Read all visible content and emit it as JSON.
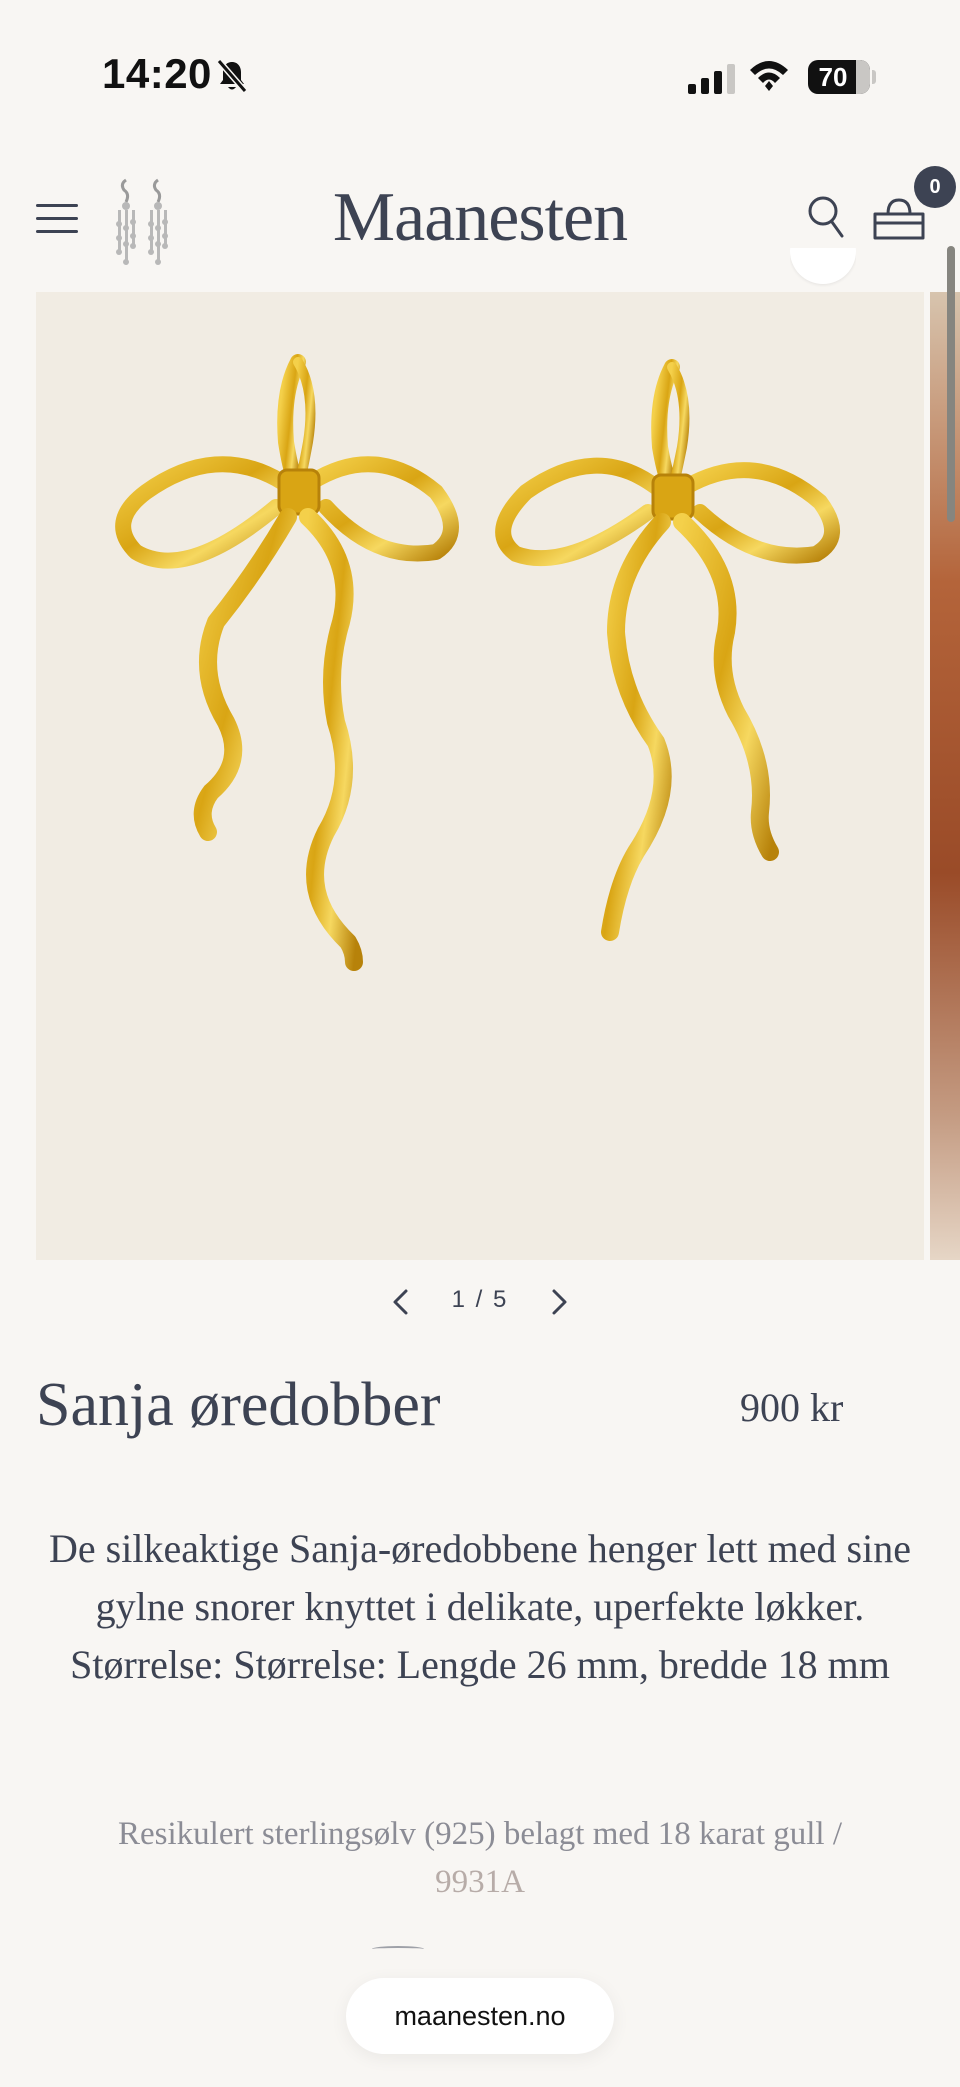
{
  "status_bar": {
    "time": "14:20",
    "battery": "70"
  },
  "header": {
    "logo": "Maanesten",
    "cart_count": "0"
  },
  "gallery": {
    "current": "1",
    "separator": "/",
    "total": "5",
    "pager_text": "1 / 5"
  },
  "product": {
    "title": "Sanja øredobber",
    "price": "900 kr",
    "description": "De silkeaktige Sanja-øredobbene henger lett med sine gylne snorer knyttet i delikate, uperfekte løkker. Størrelse: Størrelse: Lengde 26 mm, bredde 18 mm",
    "material": "Resikulert sterlingsølv (925) belagt med 18 karat gull /",
    "sku": "9931A"
  },
  "browser": {
    "url": "maanesten.no"
  },
  "colors": {
    "background": "#f8f6f3",
    "text": "#3d4353",
    "gallery_bg": "#f1ece3",
    "gold": "#d9a514"
  }
}
